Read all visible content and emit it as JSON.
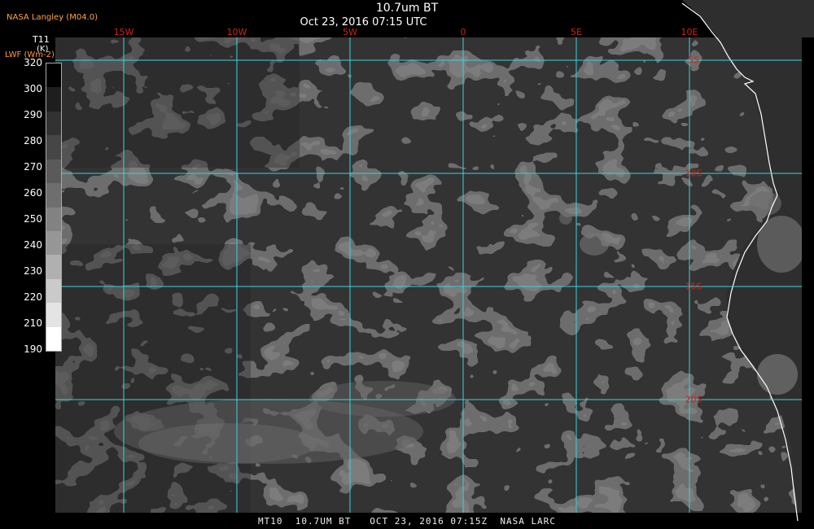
{
  "header": {
    "org": "NASA Langley (M04.0)",
    "title": "10.7um BT",
    "timestamp": "Oct 23, 2016 07:15 UTC"
  },
  "legend": {
    "variable": "T11",
    "unit": "(K)",
    "secondary": "LWF (Wm-2)",
    "ticks": [
      "320",
      "300",
      "290",
      "280",
      "270",
      "260",
      "250",
      "240",
      "230",
      "220",
      "210",
      "190"
    ],
    "colors": [
      "#000000",
      "#1e1e1e",
      "#323232",
      "#464646",
      "#5a5a5a",
      "#6e6e6e",
      "#828282",
      "#969696",
      "#b0b0b0",
      "#cacaca",
      "#e4e4e4",
      "#ffffff"
    ]
  },
  "grid": {
    "longitudes": [
      "15W",
      "10W",
      "5W",
      "0",
      "5E",
      "10E"
    ],
    "latitudes": [
      "5S",
      "10S",
      "15S",
      "20S"
    ],
    "grid_color": "#39d5dc",
    "label_color": "#d0241a",
    "coast_color": "#ffffff"
  },
  "footer": {
    "caption": "MT10  10.7UM BT   OCT 23, 2016 07:15Z  NASA LARC"
  }
}
